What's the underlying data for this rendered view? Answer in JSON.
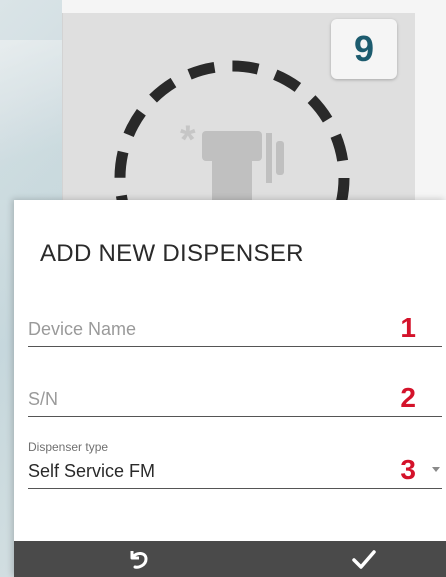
{
  "tile": {
    "badge": "9",
    "icon": "fuel-dispenser-icon"
  },
  "dialog": {
    "title": "ADD NEW DISPENSER",
    "fields": [
      {
        "placeholder": "Device Name",
        "value": "",
        "marker": "1"
      },
      {
        "placeholder": "S/N",
        "value": "",
        "marker": "2"
      },
      {
        "label": "Dispenser type",
        "value": "Self Service FM",
        "marker": "3"
      }
    ],
    "actions": {
      "undo_icon": "undo-icon",
      "confirm_icon": "checkmark-icon"
    }
  },
  "colors": {
    "marker": "#d4122a",
    "badge_text": "#1e5f73",
    "action_bar": "#4a4a4a"
  }
}
